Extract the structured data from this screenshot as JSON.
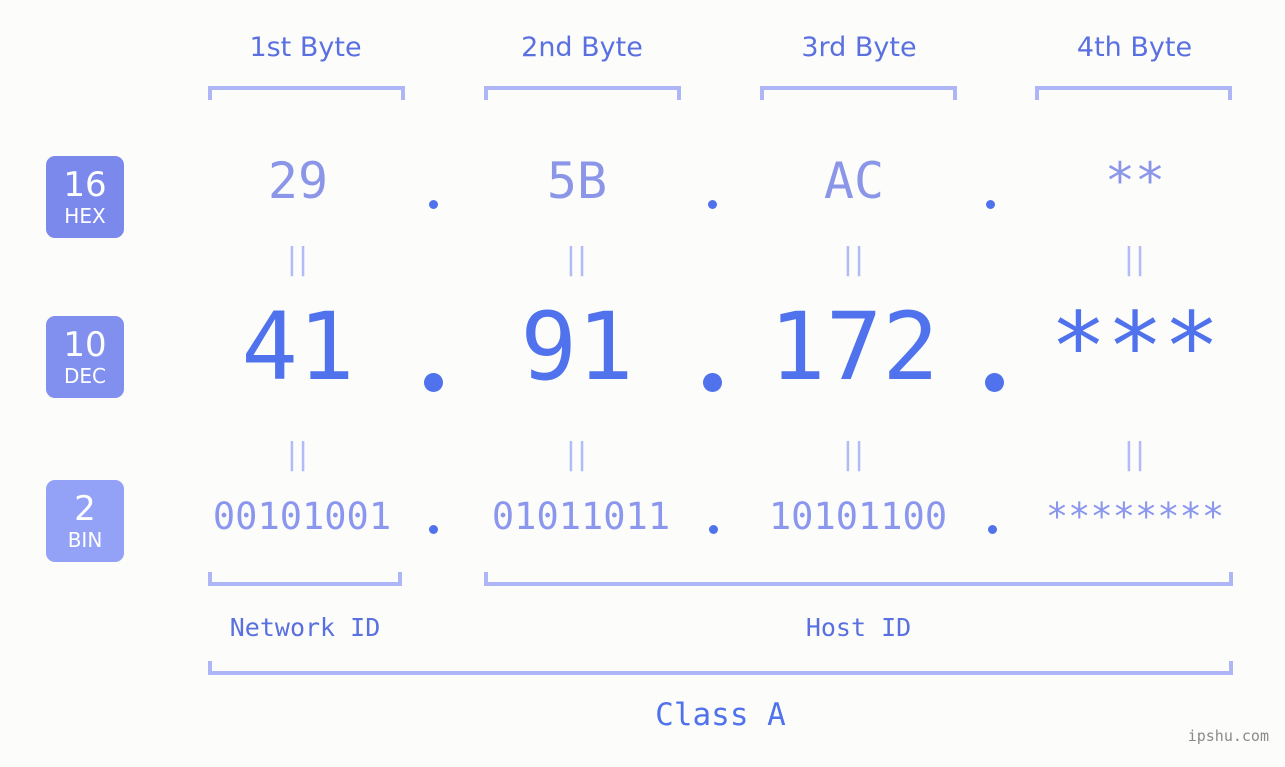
{
  "meta": {
    "background_color": "#fcfdfa",
    "accent_strong": "#5072ec",
    "accent_mid": "#8b96e8",
    "accent_light": "#aeb6f7",
    "badge_hex_color": "#7b89ec",
    "badge_dec_color": "#8190ef",
    "badge_bin_color": "#93a1f6"
  },
  "headers": [
    {
      "label": "1st Byte"
    },
    {
      "label": "2nd Byte"
    },
    {
      "label": "3rd Byte"
    },
    {
      "label": "4th Byte"
    }
  ],
  "bases": [
    {
      "number": "16",
      "name": "HEX"
    },
    {
      "number": "10",
      "name": "DEC"
    },
    {
      "number": "2",
      "name": "BIN"
    }
  ],
  "rows": {
    "hex": {
      "base_number": "16",
      "base_name": "HEX",
      "values": [
        "29",
        "5B",
        "AC",
        "**"
      ],
      "separator": "."
    },
    "dec": {
      "base_number": "10",
      "base_name": "DEC",
      "values": [
        "41",
        "91",
        "172",
        "***"
      ],
      "separator": "."
    },
    "bin": {
      "base_number": "2",
      "base_name": "BIN",
      "values": [
        "00101001",
        "01011011",
        "10101100",
        "********"
      ],
      "separator": "."
    }
  },
  "equality_marks": {
    "symbol": "||",
    "row1": [
      "||",
      "||",
      "||",
      "||"
    ],
    "row2": [
      "||",
      "||",
      "||",
      "||"
    ]
  },
  "segments": [
    {
      "label": "Network ID"
    },
    {
      "label": "Host ID"
    }
  ],
  "class": {
    "label": "Class A"
  },
  "watermark": {
    "text": "ipshu.com"
  }
}
